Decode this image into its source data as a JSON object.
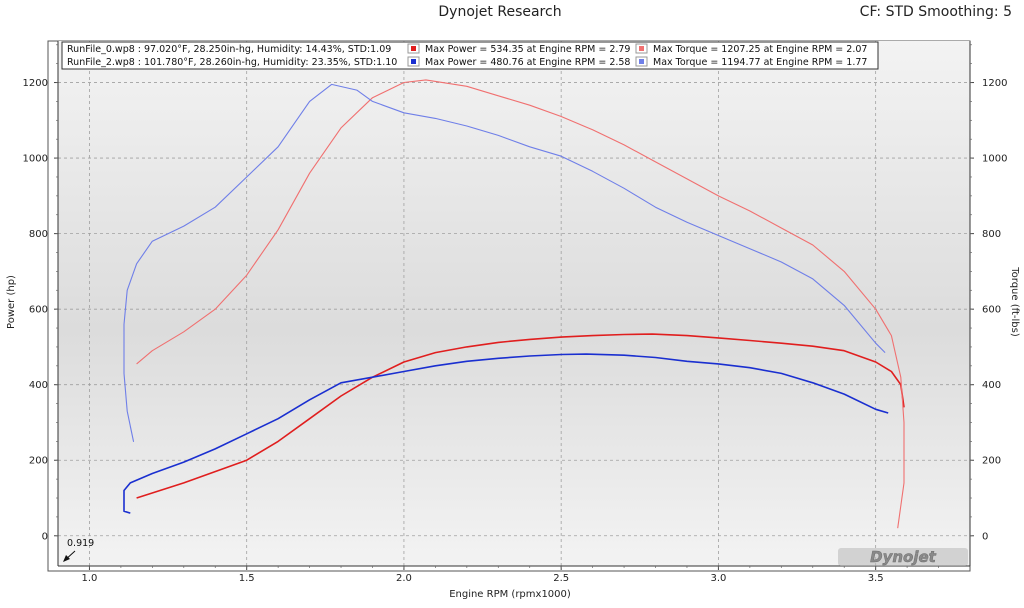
{
  "header": {
    "title": "Dynojet Research",
    "settings": "CF: STD Smoothing: 5"
  },
  "cursor_readout": "0.919",
  "logo_text": "Dynojet",
  "legend": {
    "runs": [
      {
        "info": "RunFile_0.wp8 : 97.020°F, 28.250in-hg, Humidity: 14.43%, STD:1.09",
        "power": "Max Power = 534.35 at Engine RPM = 2.79",
        "torque": "Max Torque = 1207.25 at Engine RPM = 2.07",
        "power_color": "#e01e1e",
        "torque_color": "#f07070"
      },
      {
        "info": "RunFile_2.wp8 : 101.780°F, 28.260in-hg, Humidity: 23.35%, STD:1.10",
        "power": "Max Power = 480.76 at Engine RPM = 2.58",
        "torque": "Max Torque = 1194.77 at Engine RPM = 1.77",
        "power_color": "#1a2fd0",
        "torque_color": "#6f7fe8"
      }
    ]
  },
  "chart_data": {
    "type": "line",
    "xlabel": "Engine RPM (rpmx1000)",
    "ylabel": "Power (hp)",
    "y2label": "Torque (ft-lbs)",
    "xlim": [
      0.9,
      3.8
    ],
    "ylim": [
      -80,
      1310
    ],
    "y2lim": [
      -80,
      1310
    ],
    "x_ticks": [
      "1.0",
      "1.5",
      "2.0",
      "2.5",
      "3.0",
      "3.5"
    ],
    "y_ticks": [
      "0",
      "200",
      "400",
      "600",
      "800",
      "1000",
      "1200"
    ],
    "y2_ticks": [
      "0",
      "200",
      "400",
      "600",
      "800",
      "1000",
      "1200"
    ],
    "grid": true,
    "series": [
      {
        "name": "RunFile_0 Power",
        "color": "#e01e1e",
        "axis": "left",
        "points": [
          [
            1.15,
            100
          ],
          [
            1.3,
            140
          ],
          [
            1.5,
            200
          ],
          [
            1.6,
            250
          ],
          [
            1.7,
            310
          ],
          [
            1.8,
            370
          ],
          [
            1.9,
            420
          ],
          [
            2.0,
            460
          ],
          [
            2.1,
            485
          ],
          [
            2.2,
            500
          ],
          [
            2.3,
            512
          ],
          [
            2.4,
            520
          ],
          [
            2.5,
            526
          ],
          [
            2.6,
            530
          ],
          [
            2.7,
            533
          ],
          [
            2.79,
            534
          ],
          [
            2.9,
            530
          ],
          [
            3.0,
            524
          ],
          [
            3.1,
            517
          ],
          [
            3.2,
            510
          ],
          [
            3.3,
            502
          ],
          [
            3.4,
            490
          ],
          [
            3.5,
            460
          ],
          [
            3.55,
            435
          ],
          [
            3.58,
            400
          ],
          [
            3.59,
            340
          ]
        ]
      },
      {
        "name": "RunFile_2 Power",
        "color": "#1a2fd0",
        "axis": "left",
        "points": [
          [
            1.13,
            60
          ],
          [
            1.11,
            65
          ],
          [
            1.11,
            120
          ],
          [
            1.13,
            140
          ],
          [
            1.2,
            165
          ],
          [
            1.3,
            195
          ],
          [
            1.4,
            230
          ],
          [
            1.5,
            270
          ],
          [
            1.6,
            310
          ],
          [
            1.7,
            360
          ],
          [
            1.8,
            405
          ],
          [
            1.9,
            420
          ],
          [
            2.0,
            435
          ],
          [
            2.1,
            450
          ],
          [
            2.2,
            462
          ],
          [
            2.3,
            470
          ],
          [
            2.4,
            476
          ],
          [
            2.5,
            480
          ],
          [
            2.58,
            481
          ],
          [
            2.7,
            478
          ],
          [
            2.8,
            472
          ],
          [
            2.9,
            462
          ],
          [
            3.0,
            455
          ],
          [
            3.1,
            445
          ],
          [
            3.2,
            430
          ],
          [
            3.3,
            405
          ],
          [
            3.4,
            375
          ],
          [
            3.5,
            335
          ],
          [
            3.54,
            325
          ]
        ]
      },
      {
        "name": "RunFile_0 Torque",
        "color": "#f07070",
        "axis": "right",
        "points": [
          [
            1.15,
            455
          ],
          [
            1.2,
            490
          ],
          [
            1.3,
            540
          ],
          [
            1.4,
            600
          ],
          [
            1.5,
            690
          ],
          [
            1.6,
            810
          ],
          [
            1.7,
            960
          ],
          [
            1.8,
            1080
          ],
          [
            1.9,
            1160
          ],
          [
            2.0,
            1200
          ],
          [
            2.07,
            1207
          ],
          [
            2.2,
            1190
          ],
          [
            2.3,
            1165
          ],
          [
            2.4,
            1140
          ],
          [
            2.5,
            1110
          ],
          [
            2.6,
            1075
          ],
          [
            2.7,
            1035
          ],
          [
            2.8,
            990
          ],
          [
            2.9,
            945
          ],
          [
            3.0,
            900
          ],
          [
            3.1,
            860
          ],
          [
            3.2,
            815
          ],
          [
            3.3,
            770
          ],
          [
            3.4,
            700
          ],
          [
            3.5,
            600
          ],
          [
            3.55,
            530
          ],
          [
            3.58,
            420
          ],
          [
            3.59,
            300
          ],
          [
            3.59,
            140
          ],
          [
            3.57,
            20
          ]
        ]
      },
      {
        "name": "RunFile_2 Torque",
        "color": "#6f7fe8",
        "axis": "right",
        "points": [
          [
            1.13,
            290
          ],
          [
            1.14,
            250
          ],
          [
            1.12,
            330
          ],
          [
            1.11,
            430
          ],
          [
            1.11,
            560
          ],
          [
            1.12,
            650
          ],
          [
            1.15,
            720
          ],
          [
            1.2,
            780
          ],
          [
            1.3,
            820
          ],
          [
            1.4,
            870
          ],
          [
            1.5,
            950
          ],
          [
            1.6,
            1030
          ],
          [
            1.7,
            1150
          ],
          [
            1.77,
            1195
          ],
          [
            1.85,
            1180
          ],
          [
            1.9,
            1150
          ],
          [
            2.0,
            1120
          ],
          [
            2.1,
            1105
          ],
          [
            2.2,
            1085
          ],
          [
            2.3,
            1060
          ],
          [
            2.4,
            1030
          ],
          [
            2.5,
            1005
          ],
          [
            2.6,
            965
          ],
          [
            2.7,
            920
          ],
          [
            2.8,
            870
          ],
          [
            2.9,
            830
          ],
          [
            3.0,
            795
          ],
          [
            3.1,
            760
          ],
          [
            3.2,
            725
          ],
          [
            3.3,
            680
          ],
          [
            3.4,
            610
          ],
          [
            3.5,
            510
          ],
          [
            3.53,
            485
          ]
        ]
      }
    ]
  }
}
